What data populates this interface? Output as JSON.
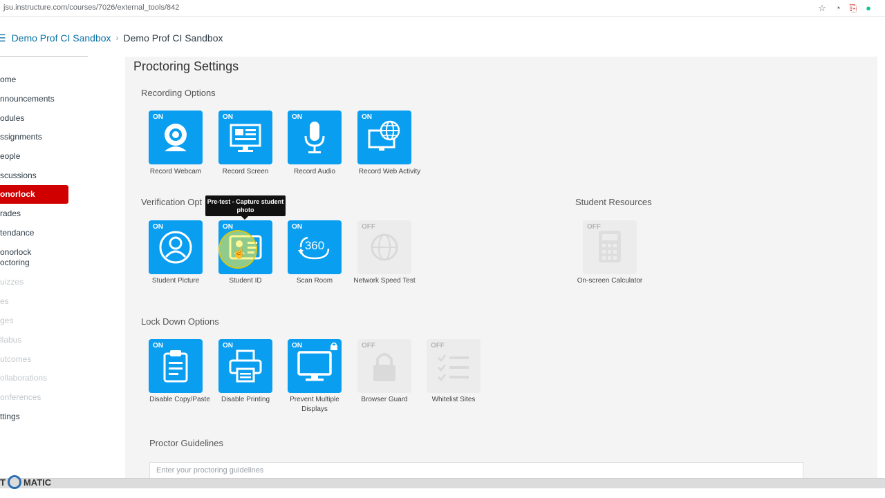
{
  "browser": {
    "url": "jsu.instructure.com/courses/7026/external_tools/842",
    "icons": [
      "star-icon",
      "extension-circle-icon",
      "pdf-icon",
      "grammarly-icon"
    ]
  },
  "breadcrumb": {
    "course_link": "Demo Prof CI Sandbox",
    "separator": "›",
    "current": "Demo Prof CI Sandbox"
  },
  "course_nav": {
    "items": [
      {
        "label": "ome",
        "faded": false
      },
      {
        "label": "nnouncements",
        "faded": false
      },
      {
        "label": "odules",
        "faded": false
      },
      {
        "label": "ssignments",
        "faded": false
      },
      {
        "label": "eople",
        "faded": false
      },
      {
        "label": "scussions",
        "faded": false
      },
      {
        "label": "onorlock",
        "active": true
      },
      {
        "label": "rades",
        "faded": false
      },
      {
        "label": "tendance",
        "faded": false
      },
      {
        "label": "onorlock\noctoring",
        "faded": false
      },
      {
        "label": "uizzes",
        "faded": true
      },
      {
        "label": "es",
        "faded": true
      },
      {
        "label": "ges",
        "faded": true
      },
      {
        "label": "llabus",
        "faded": true
      },
      {
        "label": "utcomes",
        "faded": true
      },
      {
        "label": "ollaborations",
        "faded": true
      },
      {
        "label": "onferences",
        "faded": true
      },
      {
        "label": "ttings",
        "faded": false
      }
    ]
  },
  "page": {
    "title": "Proctoring Settings"
  },
  "sections": {
    "recording": "Recording Options",
    "verification": "Verification Opt",
    "student_resources": "Student Resources",
    "lockdown": "Lock Down Options"
  },
  "tiles": {
    "record_webcam": {
      "state": "ON",
      "label": "Record Webcam",
      "icon": "webcam-icon"
    },
    "record_screen": {
      "state": "ON",
      "label": "Record Screen",
      "icon": "screen-icon"
    },
    "record_audio": {
      "state": "ON",
      "label": "Record Audio",
      "icon": "microphone-icon"
    },
    "record_web_activity": {
      "state": "ON",
      "label": "Record Web Activity",
      "icon": "globe-monitor-icon"
    },
    "student_picture": {
      "state": "ON",
      "label": "Student Picture",
      "icon": "user-circle-icon"
    },
    "student_id": {
      "state": "ON",
      "label": "Student ID",
      "icon": "id-card-icon"
    },
    "scan_room": {
      "state": "ON",
      "label": "Scan Room",
      "icon": "360-icon",
      "icon_text": "360"
    },
    "network_speed_test": {
      "state": "OFF",
      "label": "Network Speed Test",
      "icon": "globe-icon"
    },
    "onscreen_calculator": {
      "state": "OFF",
      "label": "On-screen Calculator",
      "icon": "calculator-icon"
    },
    "disable_copy_paste": {
      "state": "ON",
      "label": "Disable Copy/Paste",
      "icon": "clipboard-icon"
    },
    "disable_printing": {
      "state": "ON",
      "label": "Disable Printing",
      "icon": "printer-icon"
    },
    "prevent_multiple_displays": {
      "state": "ON",
      "label": "Prevent Multiple Displays",
      "icon": "monitor-icon",
      "locked": true
    },
    "browser_guard": {
      "state": "OFF",
      "label": "Browser Guard",
      "icon": "padlock-icon"
    },
    "whitelist_sites": {
      "state": "OFF",
      "label": "Whitelist Sites",
      "icon": "checklist-icon"
    }
  },
  "tooltip": {
    "text": "Pre-test - Capture student photo"
  },
  "guidelines": {
    "label": "Proctor Guidelines",
    "placeholder": "Enter your proctoring guidelines"
  },
  "watermark": {
    "left": "T",
    "right": "MATIC"
  },
  "colors": {
    "tile_on": "#0a9ef0",
    "tile_off": "#ececec",
    "nav_active": "#d00000",
    "link": "#0770a3"
  }
}
